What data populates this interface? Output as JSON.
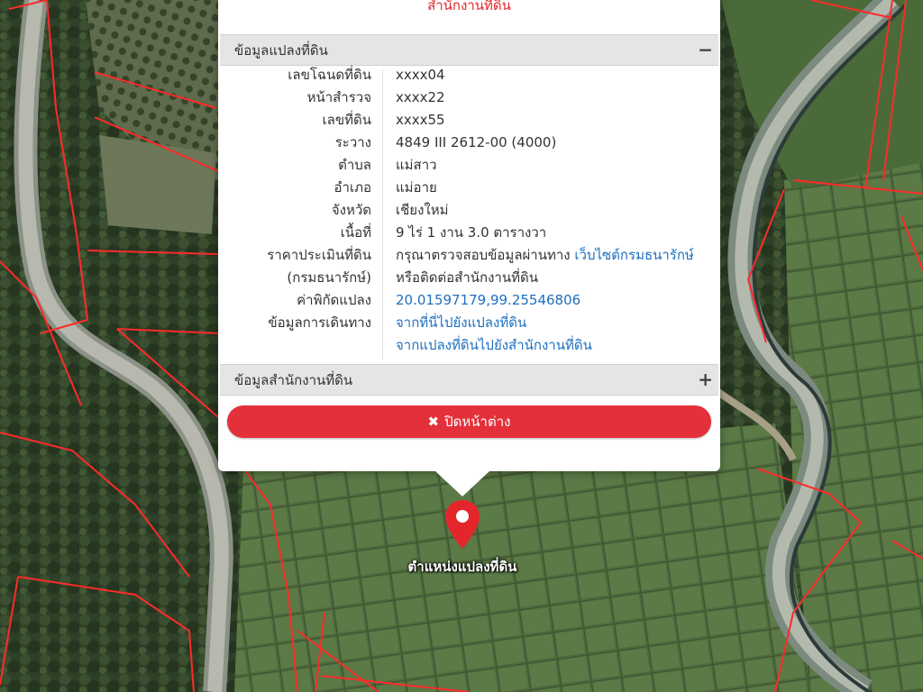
{
  "popup": {
    "title": "สำนักงานที่ดิน",
    "parcel_section": {
      "header": "ข้อมูลแปลงที่ดิน",
      "toggle": "−",
      "rows": [
        {
          "label": "เลขโฉนดที่ดิน",
          "value": "xxxx04"
        },
        {
          "label": "หน้าสำรวจ",
          "value": "xxxx22"
        },
        {
          "label": "เลขที่ดิน",
          "value": "xxxx55"
        },
        {
          "label": "ระวาง",
          "value": "4849 III 2612-00 (4000)"
        },
        {
          "label": "ตำบล",
          "value": "แม่สาว"
        },
        {
          "label": "อำเภอ",
          "value": "แม่อาย"
        },
        {
          "label": "จังหวัด",
          "value": "เชียงใหม่"
        },
        {
          "label": "เนื้อที่",
          "value": "9 ไร่ 1 งาน 3.0 ตารางวา"
        },
        {
          "label": "ราคาประเมินที่ดิน",
          "value": "กรุณาตรวจสอบข้อมูลผ่านทาง ",
          "link": "เว็บไซต์กรมธนารักษ์"
        },
        {
          "label": "(กรมธนารักษ์)",
          "value": "หรือติดต่อสำนักงานที่ดิน"
        },
        {
          "label": "ค่าพิกัดแปลง",
          "link": "20.01597179,99.25546806"
        },
        {
          "label": "ข้อมูลการเดินทาง",
          "link": "จากที่นี่ไปยังแปลงที่ดิน"
        },
        {
          "label": "",
          "link": "จากแปลงที่ดินไปยังสำนักงานที่ดิน"
        }
      ]
    },
    "office_section": {
      "header": "ข้อมูลสำนักงานที่ดิน",
      "toggle": "+"
    },
    "close_button": {
      "icon": "✖",
      "label": "ปิดหน้าต่าง"
    }
  },
  "marker": {
    "label": "ตำแหน่งแปลงที่ดิน",
    "color": "#e3262b"
  },
  "colors": {
    "accent_red": "#e3303a",
    "link_blue": "#1f6fbf",
    "parcel_line": "#ff2a2a"
  }
}
